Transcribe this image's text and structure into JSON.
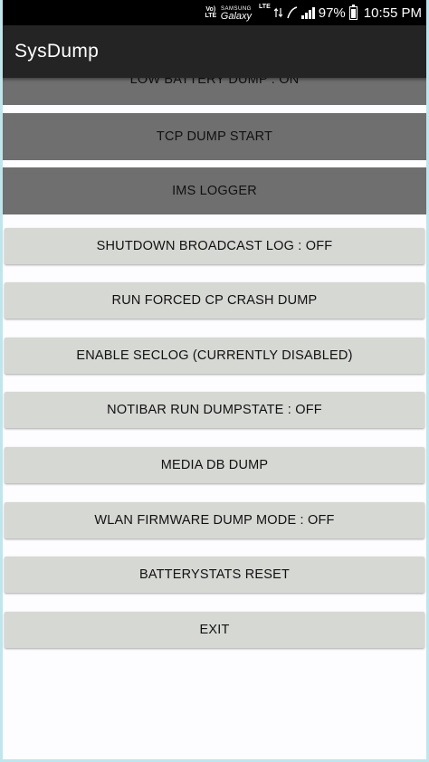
{
  "status_bar": {
    "volte": "Vo) LTE",
    "brand_top": "SAMSUNG",
    "brand": "Galaxy",
    "lte": "LTE",
    "battery_pct": "97%",
    "time": "10:55 PM"
  },
  "app_bar": {
    "title": "SysDump"
  },
  "buttons": [
    {
      "label": "LOW BATTERY DUMP : ON"
    },
    {
      "label": "TCP DUMP START"
    },
    {
      "label": "IMS LOGGER"
    },
    {
      "label": "SHUTDOWN BROADCAST LOG : OFF"
    },
    {
      "label": "RUN FORCED CP CRASH DUMP"
    },
    {
      "label": "ENABLE SECLOG (CURRENTLY DISABLED)"
    },
    {
      "label": "NOTIBAR RUN DUMPSTATE : OFF"
    },
    {
      "label": "MEDIA DB DUMP"
    },
    {
      "label": "WLAN FIRMWARE DUMP MODE : OFF"
    },
    {
      "label": "BATTERYSTATS RESET"
    },
    {
      "label": "EXIT"
    }
  ]
}
